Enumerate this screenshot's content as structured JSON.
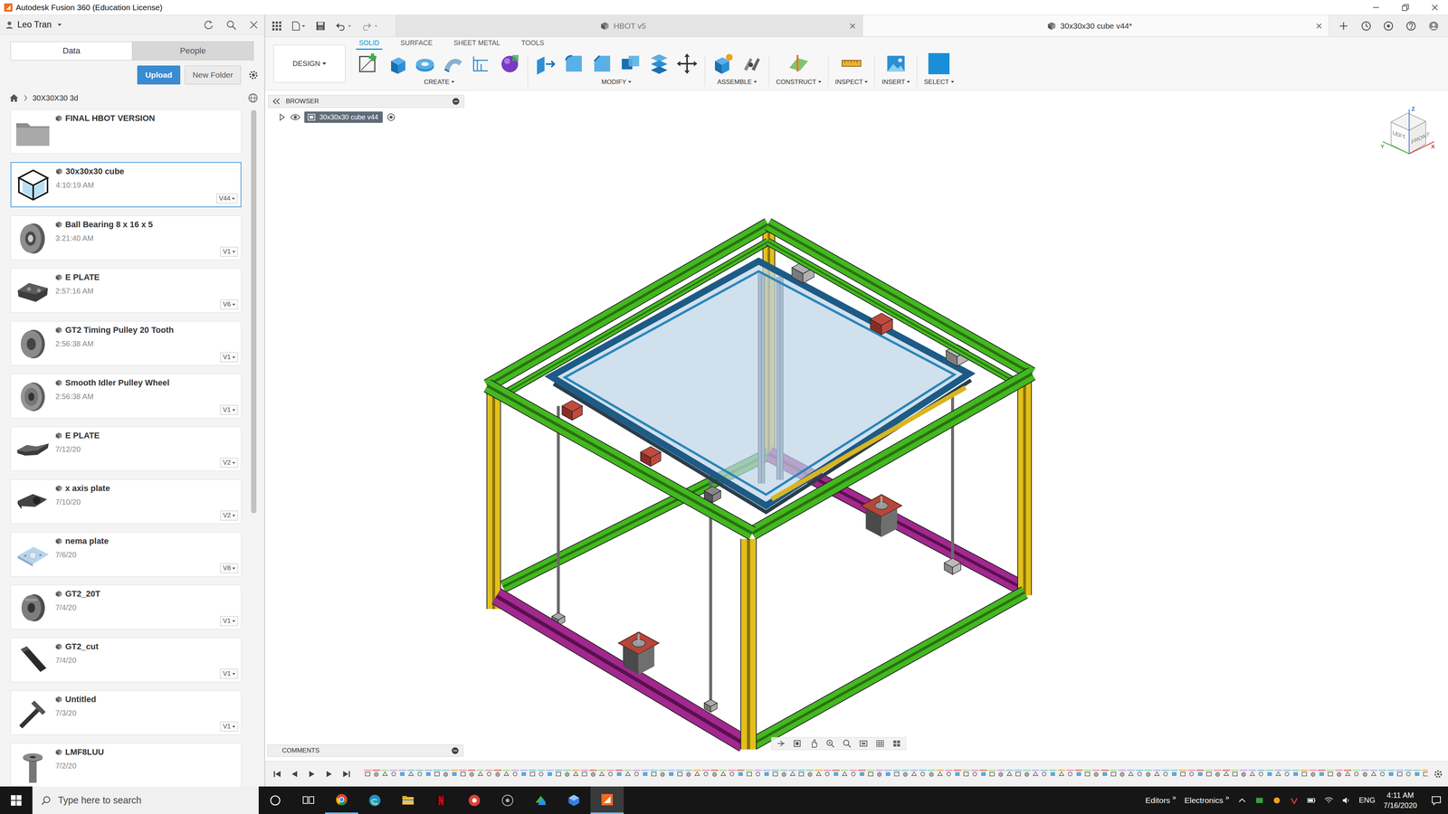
{
  "window": {
    "title": "Autodesk Fusion 360 (Education License)"
  },
  "data_panel": {
    "user": "Leo Tran",
    "tabs": [
      {
        "label": "Data",
        "selected": true
      },
      {
        "label": "People",
        "selected": false
      }
    ],
    "buttons": [
      {
        "label": "Upload",
        "kind": "primary"
      },
      {
        "label": "New Folder",
        "kind": "secondary"
      }
    ],
    "breadcrumb": "30X30X30 3d",
    "items": [
      {
        "name": "FINAL HBOT VERSION",
        "kind": "folder",
        "selected": false
      },
      {
        "name": "30x30x30 cube",
        "time": "4:10:19 AM",
        "version": "V44",
        "kind": "design",
        "selected": true
      },
      {
        "name": "Ball Bearing 8 x 16 x 5",
        "time": "3:21:40 AM",
        "version": "V1",
        "kind": "design",
        "selected": false
      },
      {
        "name": "E PLATE",
        "time": "2:57:16 AM",
        "version": "V6",
        "kind": "design",
        "selected": false
      },
      {
        "name": "GT2 Timing Pulley 20 Tooth",
        "time": "2:56:38 AM",
        "version": "V1",
        "kind": "design",
        "selected": false
      },
      {
        "name": "Smooth Idler Pulley Wheel",
        "time": "2:56:38 AM",
        "version": "V1",
        "kind": "design",
        "selected": false
      },
      {
        "name": "E PLATE",
        "time": "7/12/20",
        "version": "V2",
        "kind": "design",
        "selected": false
      },
      {
        "name": "x axis plate",
        "time": "7/10/20",
        "version": "V2",
        "kind": "design",
        "selected": false
      },
      {
        "name": "nema plate",
        "time": "7/6/20",
        "version": "V8",
        "kind": "design",
        "selected": false
      },
      {
        "name": "GT2_20T",
        "time": "7/4/20",
        "version": "V1",
        "kind": "design",
        "selected": false
      },
      {
        "name": "GT2_cut",
        "time": "7/4/20",
        "version": "V1",
        "kind": "design",
        "selected": false
      },
      {
        "name": "Untitled",
        "time": "7/3/20",
        "version": "V1",
        "kind": "design",
        "selected": false
      },
      {
        "name": "LMF8LUU",
        "time": "7/2/20",
        "kind": "design",
        "selected": false
      }
    ]
  },
  "document_tabs": [
    {
      "label": "HBOT v5",
      "selected": false
    },
    {
      "label": "30x30x30 cube v44*",
      "selected": true
    }
  ],
  "toolbar": {
    "workspace": "DESIGN",
    "tabs": [
      {
        "label": "SOLID",
        "selected": true
      },
      {
        "label": "SURFACE",
        "selected": false
      },
      {
        "label": "SHEET METAL",
        "selected": false
      },
      {
        "label": "TOOLS",
        "selected": false
      }
    ],
    "groups": [
      {
        "label": "CREATE"
      },
      {
        "label": "MODIFY"
      },
      {
        "label": "ASSEMBLE"
      },
      {
        "label": "CONSTRUCT"
      },
      {
        "label": "INSPECT"
      },
      {
        "label": "INSERT"
      },
      {
        "label": "SELECT"
      }
    ]
  },
  "browser": {
    "title": "BROWSER",
    "root": {
      "label": "30x30x30 cube v44",
      "expanded": false,
      "visible": true
    }
  },
  "view_cube": {
    "faces": [
      {
        "label": "LEFT"
      },
      {
        "label": "FRONT"
      }
    ],
    "axes": [
      {
        "label": "Z"
      },
      {
        "label": "X"
      },
      {
        "label": "Y"
      }
    ]
  },
  "comments": {
    "title": "COMMENTS"
  },
  "taskbar": {
    "search": {
      "placeholder": "Type here to search"
    },
    "toolbars": [
      {
        "label": "Editors",
        "chevron": "»"
      },
      {
        "label": "Electronics",
        "chevron": "»"
      }
    ],
    "language": "ENG",
    "time": "4:11 AM",
    "date": "7/16/2020"
  }
}
